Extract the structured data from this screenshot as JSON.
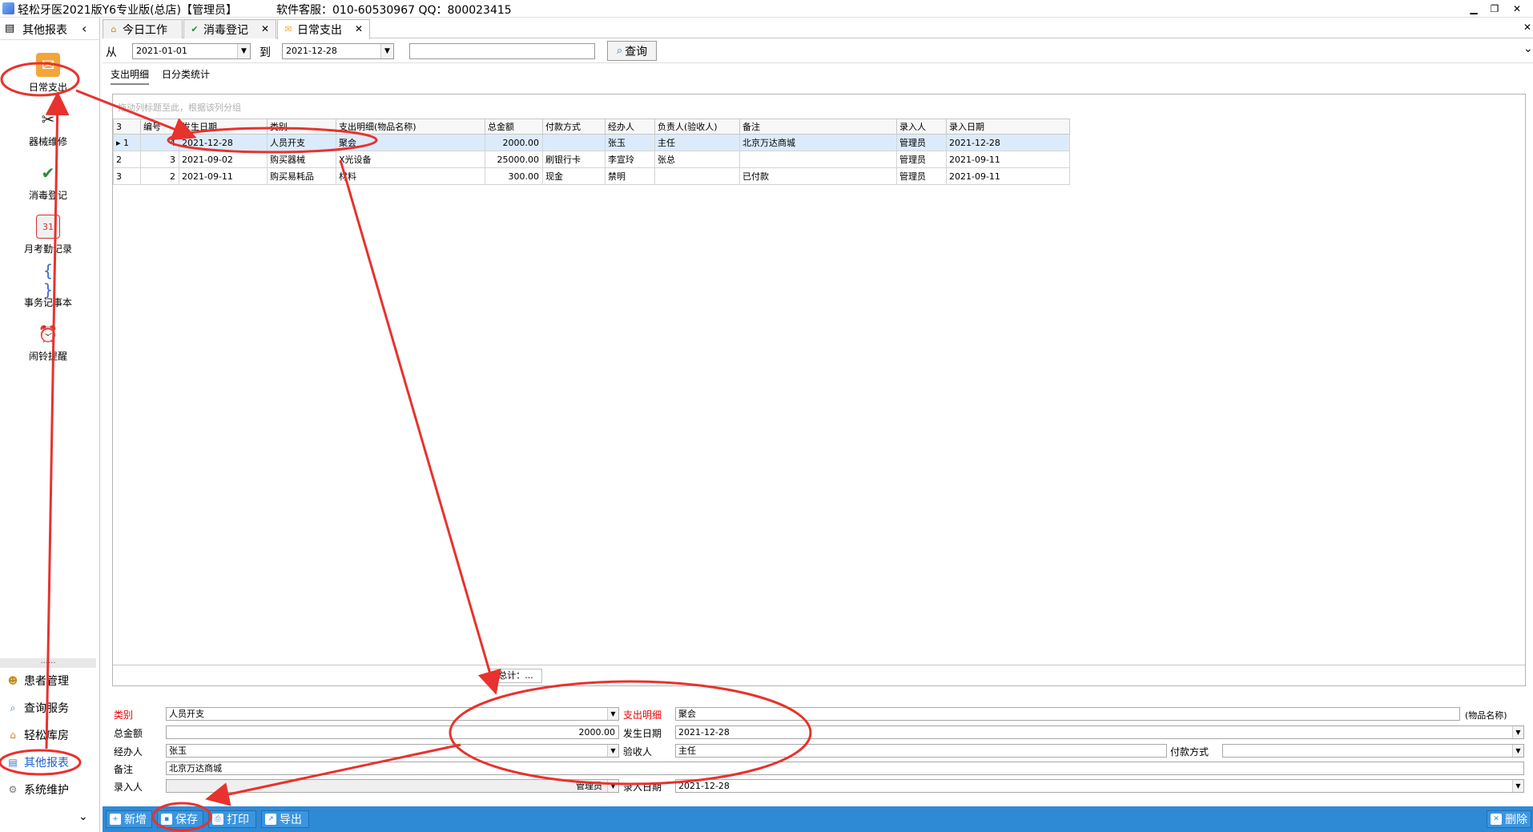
{
  "window": {
    "title": "轻松牙医2021版Y6专业版(总店)【管理员】",
    "support": "软件客服：010-60530967 QQ：800023415",
    "minimize": "▁",
    "restore": "❐",
    "close": "✕"
  },
  "sidebar": {
    "header": "其他报表",
    "collapse": "‹",
    "tiles": [
      {
        "label": "日常支出",
        "icon": "expense-icon"
      },
      {
        "label": "器械维修",
        "icon": "tools-icon"
      },
      {
        "label": "消毒登记",
        "icon": "disinfect-icon"
      },
      {
        "label": "月考勤记录",
        "icon": "calendar-icon"
      },
      {
        "label": "事务记事本",
        "icon": "notebook-icon"
      },
      {
        "label": "闹铃提醒",
        "icon": "alarm-clock-icon"
      }
    ],
    "dots": "......",
    "nav": [
      {
        "label": "患者管理",
        "icon": "patients-icon"
      },
      {
        "label": "查询服务",
        "icon": "query-icon"
      },
      {
        "label": "轻松库房",
        "icon": "warehouse-icon"
      },
      {
        "label": "其他报表",
        "icon": "report-icon"
      },
      {
        "label": "系统维护",
        "icon": "maintenance-icon"
      }
    ],
    "more": "⌄"
  },
  "tabs": [
    {
      "label": "今日工作"
    },
    {
      "label": "消毒登记",
      "close": "✕"
    },
    {
      "label": "日常支出",
      "close": "✕"
    }
  ],
  "tabs_close_all": "✕",
  "filter": {
    "from_label": "从",
    "from": "2021-01-01",
    "to_label": "到",
    "to": "2021-12-28",
    "keyword": "",
    "query_button": "查询",
    "expand": "⌄"
  },
  "subtabs": [
    "支出明细",
    "日分类统计"
  ],
  "grid": {
    "group_hint": "拖动列标题至此，根据该列分组",
    "row_count": "3",
    "columns": [
      "编号",
      "发生日期",
      "类别",
      "支出明细(物品名称)",
      "总金额",
      "付款方式",
      "经办人",
      "负责人(验收人)",
      "备注",
      "录入人",
      "录入日期"
    ],
    "rows": [
      {
        "idx": "1",
        "marker": "▸",
        "cells": [
          "4",
          "2021-12-28",
          "人员开支",
          "聚会",
          "2000.00",
          "",
          "张玉",
          "主任",
          "北京万达商城",
          "管理员",
          "2021-12-28"
        ]
      },
      {
        "idx": "2",
        "marker": "",
        "cells": [
          "3",
          "2021-09-02",
          "购买器械",
          "X光设备",
          "25000.00",
          "刷银行卡",
          "李宣玲",
          "张总",
          "",
          "管理员",
          "2021-09-11"
        ]
      },
      {
        "idx": "3",
        "marker": "",
        "cells": [
          "2",
          "2021-09-11",
          "购买易耗品",
          "材料",
          "300.00",
          "现金",
          "禁明",
          "",
          "已付款",
          "管理员",
          "2021-09-11"
        ]
      }
    ],
    "sum_label": "总计：..."
  },
  "form": {
    "category_label": "类别",
    "category": "人员开支",
    "detail_label": "支出明细",
    "detail": "聚会",
    "detail_suffix": "(物品名称)",
    "amount_label": "总金额",
    "amount": "2000.00",
    "date_label": "发生日期",
    "date": "2021-12-28",
    "handler_label": "经办人",
    "handler": "张玉",
    "inspector_label": "验收人",
    "inspector": "主任",
    "payment_label": "付款方式",
    "payment": "",
    "note_label": "备注",
    "note": "北京万达商城",
    "entered_by_label": "录入人",
    "entered_by": "管理员",
    "entry_date_label": "录入日期",
    "entry_date": "2021-12-28"
  },
  "toolbar": {
    "add": "新增",
    "save": "保存",
    "print": "打印",
    "export": "导出",
    "delete": "删除"
  },
  "colors": {
    "annotation": "#e8322d",
    "bottom_bar": "#2f8ad6",
    "required_label": "#e00000",
    "selected_row": "#dcebfb"
  }
}
